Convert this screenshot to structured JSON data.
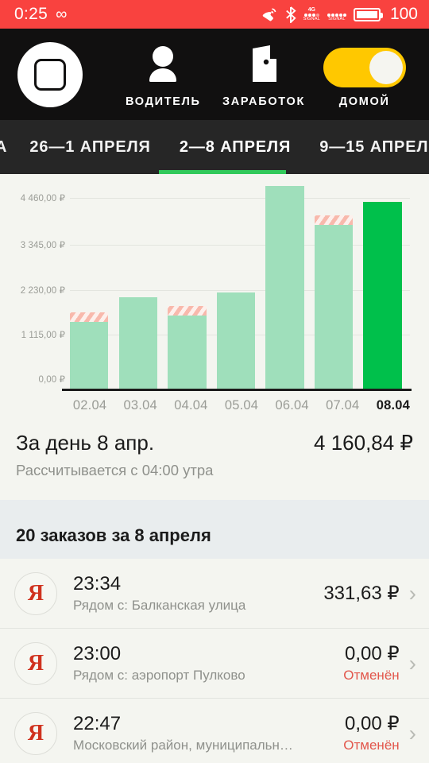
{
  "status_bar": {
    "time": "0:25",
    "infinity_icon": "infinity-icon",
    "missed_call_icon": "missed-call-icon",
    "bluetooth_icon": "bluetooth-icon",
    "sim1": {
      "generation": "4G",
      "label": "SIGNAL",
      "bars_filled": 3,
      "bars_total": 4
    },
    "sim2": {
      "generation": "",
      "label": "SIGNAL",
      "bars_filled": 5,
      "bars_total": 5
    },
    "battery_percent": "100",
    "background_color": "#f9423f"
  },
  "top_nav": {
    "home_button": "home-square-icon",
    "items": [
      {
        "label": "ВОДИТЕЛЬ",
        "icon": "driver-person-icon"
      },
      {
        "label": "ЗАРАБОТОК",
        "icon": "wallet-icon"
      },
      {
        "label": "ДОМОЙ",
        "icon": "toggle-switch-icon",
        "toggle_on": true
      }
    ],
    "toggle_color": "#ffc800",
    "background_color": "#111010"
  },
  "tabs": {
    "items": [
      {
        "label": "А",
        "active": false,
        "truncated": true
      },
      {
        "label": "26—1 АПРЕЛЯ",
        "active": false
      },
      {
        "label": "2—8 АПРЕЛЯ",
        "active": true
      },
      {
        "label": "9—15 АПРЕЛЯ",
        "active": false
      }
    ],
    "active_indicator_color": "#31c95a"
  },
  "chart_data": {
    "type": "bar",
    "title": "",
    "xlabel": "",
    "ylabel": "",
    "categories": [
      "02.04",
      "03.04",
      "04.04",
      "05.04",
      "06.04",
      "07.04",
      "08.04"
    ],
    "values": [
      1485,
      2035,
      1625,
      2150,
      4520,
      3640,
      4161
    ],
    "ylim": [
      0,
      4460
    ],
    "ytick_values": [
      0,
      1115,
      2230,
      3345,
      4460
    ],
    "ytick_labels": [
      "0,00 ₽",
      "1 115,00 ₽",
      "2 230,00 ₽",
      "3 345,00 ₽",
      "4 460,00 ₽"
    ],
    "grid": true,
    "legend": "none",
    "bar_color": "#9fdfbb",
    "highlight_color": "#00c04b",
    "highlight_index": 6,
    "striped_top_indices": [
      0,
      2,
      5
    ],
    "stripe_colors": [
      "#f8b9ac",
      "#fdf0ec"
    ]
  },
  "summary": {
    "title": "За день 8 апр.",
    "amount": "4 160,84 ₽",
    "subtitle": "Рассчитывается с 04:00 утра"
  },
  "orders_section": {
    "header": "20 заказов за 8 апреля",
    "items": [
      {
        "avatar": "Я",
        "time": "23:34",
        "address": "Рядом с: Балканская улица",
        "price": "331,63 ₽",
        "status": "",
        "chevron": "chevron-right-icon"
      },
      {
        "avatar": "Я",
        "time": "23:00",
        "address": "Рядом с: аэропорт Пулково",
        "price": "0,00 ₽",
        "status": "Отменён",
        "chevron": "chevron-right-icon"
      },
      {
        "avatar": "Я",
        "time": "22:47",
        "address": "Московский район, муниципальн…",
        "price": "0,00 ₽",
        "status": "Отменён",
        "chevron": "chevron-right-icon"
      }
    ]
  }
}
